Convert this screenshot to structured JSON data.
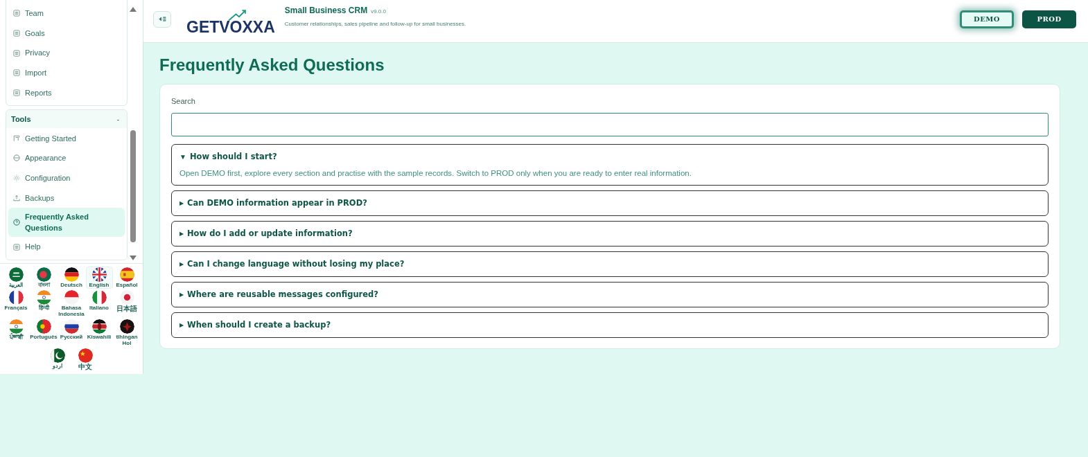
{
  "sidebar": {
    "groups": [
      {
        "items": [
          {
            "label": "Team",
            "selected": false
          },
          {
            "label": "Goals",
            "selected": false
          },
          {
            "label": "Privacy",
            "selected": false
          },
          {
            "label": "Import",
            "selected": false
          },
          {
            "label": "Reports",
            "selected": false
          }
        ]
      },
      {
        "title": "Tools",
        "toggle": "-",
        "items": [
          {
            "label": "Getting Started",
            "selected": false
          },
          {
            "label": "Appearance",
            "selected": false
          },
          {
            "label": "Configuration",
            "selected": false
          },
          {
            "label": "Backups",
            "selected": false
          },
          {
            "label": "Frequently Asked Questions",
            "selected": true
          },
          {
            "label": "Help",
            "selected": false
          }
        ]
      }
    ],
    "languages": [
      {
        "label": "العربية",
        "selected": false,
        "cjk": false
      },
      {
        "label": "বাংলা",
        "selected": false,
        "cjk": false
      },
      {
        "label": "Deutsch",
        "selected": false,
        "cjk": false
      },
      {
        "label": "English",
        "selected": true,
        "cjk": false
      },
      {
        "label": "Español",
        "selected": false,
        "cjk": false
      },
      {
        "label": "Français",
        "selected": false,
        "cjk": false
      },
      {
        "label": "हिन्दी",
        "selected": false,
        "cjk": false
      },
      {
        "label": "Bahasa Indonesia",
        "selected": false,
        "cjk": false
      },
      {
        "label": "Italiano",
        "selected": false,
        "cjk": false
      },
      {
        "label": "日本語",
        "selected": false,
        "cjk": true
      },
      {
        "label": "ਪੰਜਾਬੀ",
        "selected": false,
        "cjk": false
      },
      {
        "label": "Português",
        "selected": false,
        "cjk": false
      },
      {
        "label": "Русский",
        "selected": false,
        "cjk": false
      },
      {
        "label": "Kiswahili",
        "selected": false,
        "cjk": false
      },
      {
        "label": "tlhIngan Hol",
        "selected": false,
        "cjk": false
      },
      {
        "label": "اردو",
        "selected": false,
        "cjk": false
      },
      {
        "label": "中文",
        "selected": false,
        "cjk": true
      }
    ]
  },
  "header": {
    "logo": "GETVOXXA",
    "app_title": "Small Business CRM",
    "version": "v9.0.0",
    "subtitle": "Customer relationships, sales pipeline and follow-up for small businesses.",
    "modes": [
      {
        "label": "DEMO",
        "selected": true
      },
      {
        "label": "PROD",
        "selected": false
      }
    ]
  },
  "page": {
    "title": "Frequently Asked Questions",
    "search": {
      "label": "Search"
    },
    "faq": [
      {
        "marker": "▼",
        "question": "How should I start?",
        "expanded": true,
        "answer": "Open DEMO first, explore every section and practise with the sample records. Switch to PROD only when you are ready to enter real information."
      },
      {
        "marker": "▶",
        "question": "Can DEMO information appear in PROD?",
        "expanded": false
      },
      {
        "marker": "▶",
        "question": "How do I add or update information?",
        "expanded": false
      },
      {
        "marker": "▶",
        "question": "Can I change language without losing my place?",
        "expanded": false
      },
      {
        "marker": "▶",
        "question": "Where are reusable messages configured?",
        "expanded": false
      },
      {
        "marker": "▶",
        "question": "When should I create a backup?",
        "expanded": false
      }
    ]
  }
}
